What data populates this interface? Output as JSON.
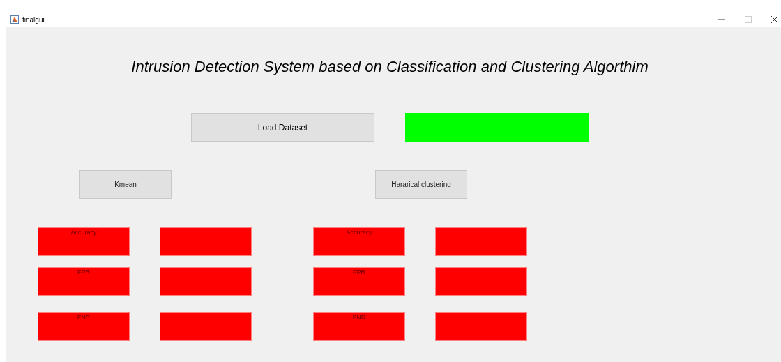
{
  "window": {
    "title": "finalgui"
  },
  "heading": "Intrusion Detection System based on Classification and Clustering Algorthim",
  "load_button": "Load Dataset",
  "status_indicator": {
    "color": "#00ff00"
  },
  "sections": [
    {
      "button": "Kmean",
      "metrics": [
        {
          "label": "Accuracy"
        },
        {
          "label": "FPR"
        },
        {
          "label": "FNR"
        }
      ]
    },
    {
      "button": "Hararical clustering",
      "metrics": [
        {
          "label": "Accuracy"
        },
        {
          "label": "FPR"
        },
        {
          "label": "FNR"
        }
      ]
    }
  ]
}
